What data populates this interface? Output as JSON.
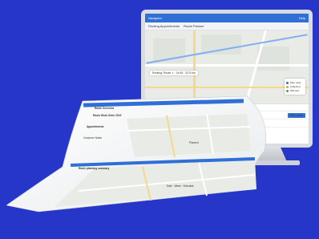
{
  "app": {
    "title": "Navigator",
    "header_right": "Help"
  },
  "tabs": [
    "Routing Appointments",
    "Route Planner"
  ],
  "map_chip": "Routing: Route 1 · 14:06 · 32.5 km",
  "legend": [
    {
      "label": "Plan route",
      "color": "#2f6fd6"
    },
    {
      "label": "Collected",
      "color": "#f0a020"
    },
    {
      "label": "Planned",
      "color": "#2fb344"
    }
  ],
  "panel": {
    "tabs": [
      "Routes",
      "Appointments",
      "Visits",
      "Statistics",
      "Conflicts"
    ],
    "row1": "New destination for Hillerod Route",
    "row1_action": "Plan route",
    "row2": "Route details"
  },
  "sheet": {
    "header": "Route Overview",
    "section1": "Route Work Order 2019",
    "section2": "Appointments",
    "section3": "Customer Notes",
    "status": "Planned",
    "bottom_title": "Route planning summary",
    "footer": "Date · Week · Schedule"
  }
}
